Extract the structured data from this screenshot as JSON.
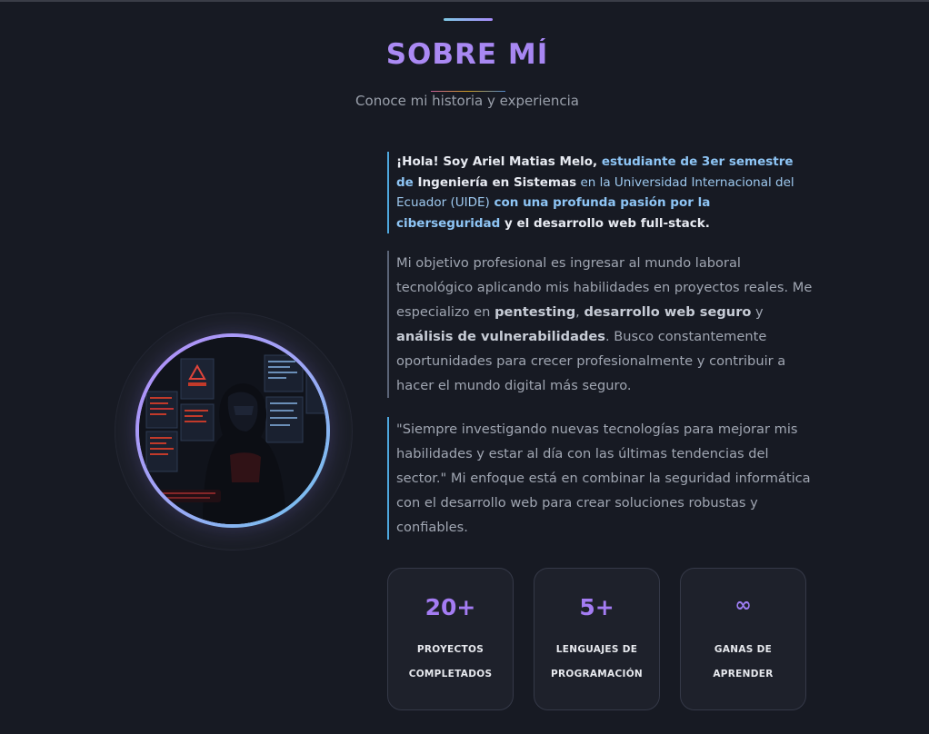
{
  "section": {
    "title": "SOBRE MÍ",
    "subtitle": "Conoce mi historia y experiencia"
  },
  "intro": {
    "t1": "¡Hola! Soy Ariel Matias Melo,",
    "t2": " estudiante de 3er semestre de ",
    "t3": "Ingeniería en Sistemas",
    "t4": " en la ",
    "t5": "Universidad Internacional del Ecuador (UIDE)",
    "t6": " con una profunda pasión por la ",
    "t7": "ciberseguridad",
    "t8": " y el ",
    "t9": "desarrollo web full-stack",
    "t10": "."
  },
  "objective": {
    "t1": "Mi objetivo profesional es ingresar al mundo laboral tecnológico aplicando mis habilidades en proyectos reales. Me especializo en ",
    "t2": "pentesting",
    "t3": ", ",
    "t4": "desarrollo web seguro",
    "t5": " y ",
    "t6": "análisis de vulnerabilidades",
    "t7": ". Busco constantemente oportunidades para crecer profesionalmente y contribuir a hacer el mundo digital más seguro."
  },
  "quote": {
    "text": "\"Siempre investigando nuevas tecnologías para mejorar mis habilidades y estar al día con las últimas tendencias del sector.\" Mi enfoque está en combinar la seguridad informática con el desarrollo web para crear soluciones robustas y confiables."
  },
  "stats": [
    {
      "value": "20+",
      "line1": "PROYECTOS",
      "line2": "COMPLETADOS"
    },
    {
      "value": "5+",
      "line1": "LENGUAJES DE",
      "line2": "PROGRAMACIÓN"
    },
    {
      "value": "∞",
      "line1": "GANAS DE",
      "line2": "APRENDER"
    }
  ],
  "colors": {
    "background": "#171a23",
    "accent_purple": "#a47cf3",
    "accent_blue": "#4ea8de"
  },
  "avatar": {
    "icon": "hooded-hacker-image"
  }
}
